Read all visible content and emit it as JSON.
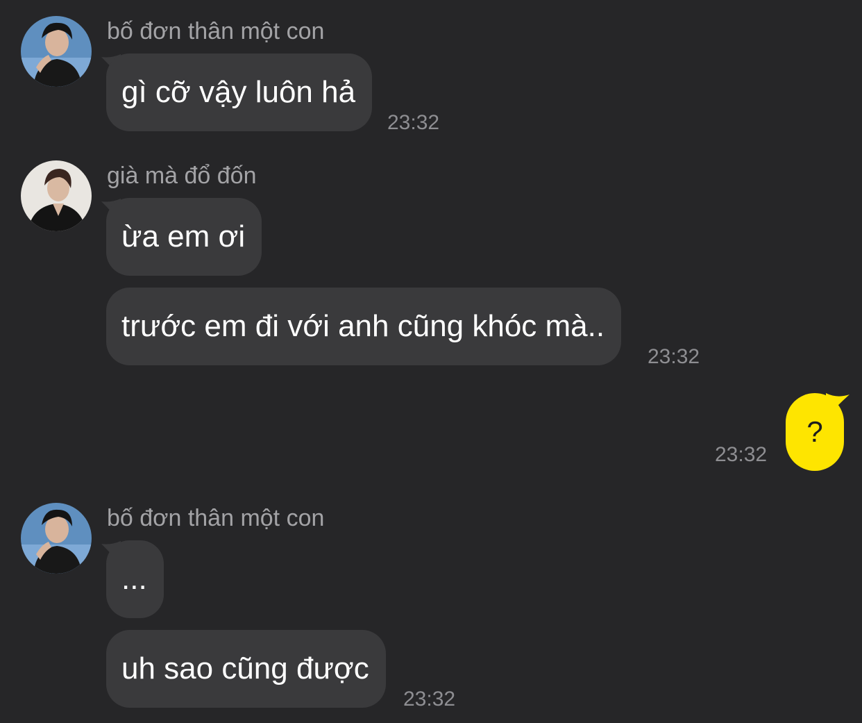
{
  "messages": [
    {
      "sender": "bố đơn thân một con",
      "bubbles": [
        "gì cỡ vậy luôn hả"
      ],
      "time": "23:32"
    },
    {
      "sender": "già mà đổ đốn",
      "bubbles": [
        "ừa em ơi",
        "trước em đi với anh cũng khóc mà.."
      ],
      "time": "23:32"
    },
    {
      "own": true,
      "bubbles": [
        "?"
      ],
      "time": "23:32"
    },
    {
      "sender": "bố đơn thân một con",
      "bubbles": [
        "...",
        "uh sao cũng được"
      ],
      "time": "23:32"
    }
  ],
  "colors": {
    "background": "#262628",
    "incoming_bubble": "#3a3a3c",
    "outgoing_bubble": "#fee500",
    "sender_name": "#a3a3a6",
    "timestamp": "#8e8e92"
  }
}
